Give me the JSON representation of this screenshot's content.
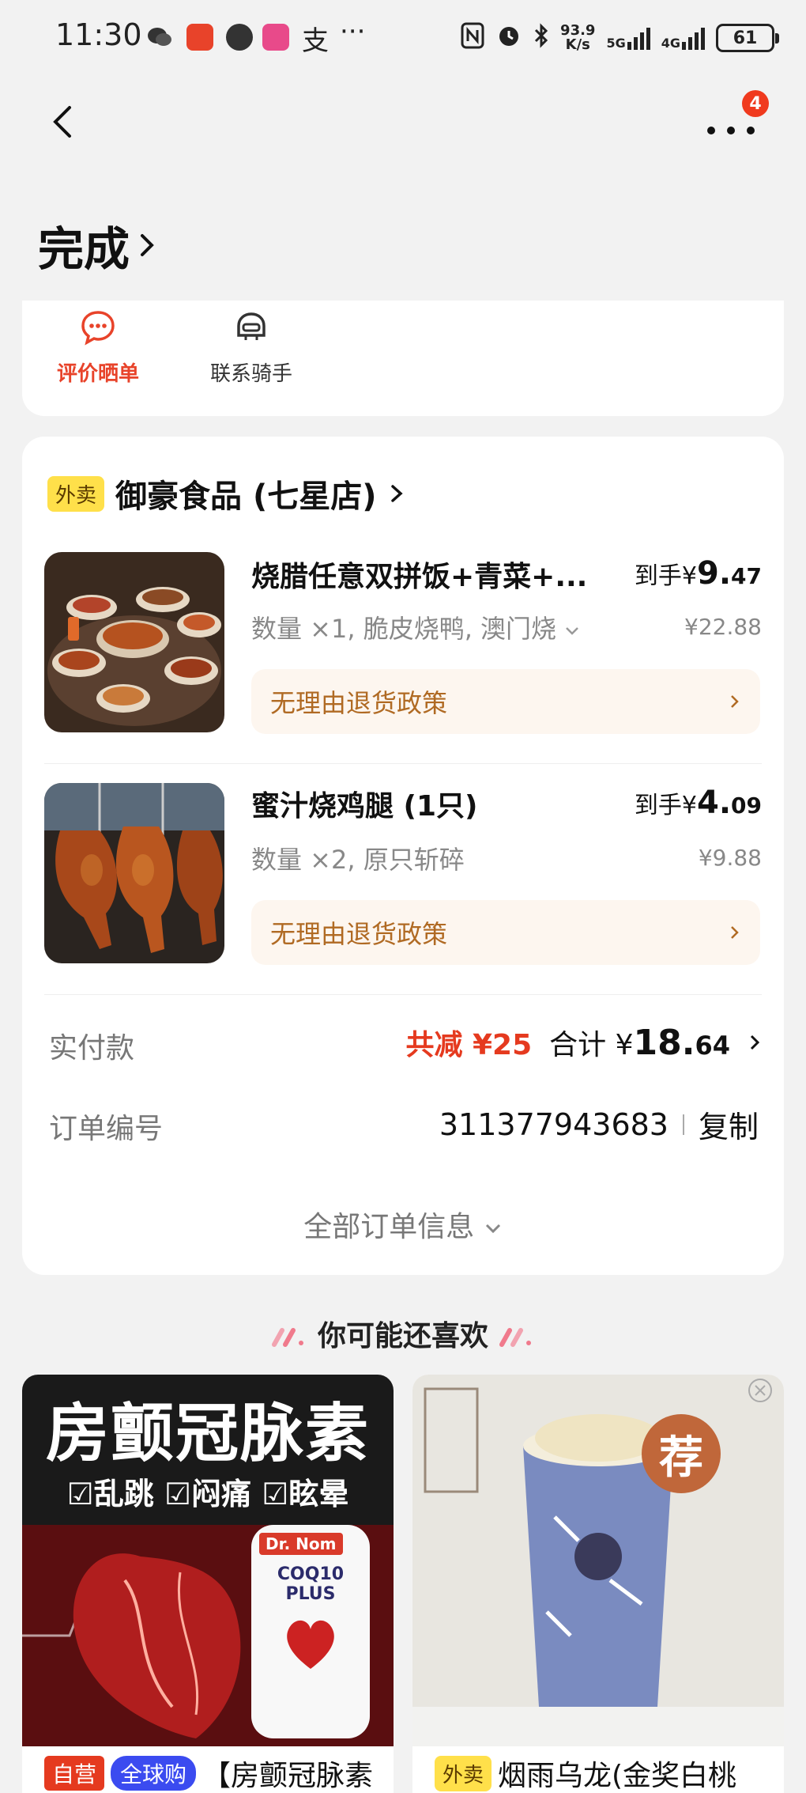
{
  "status_bar": {
    "time": "11:30",
    "net_speed_value": "93.9",
    "net_speed_unit": "K/s",
    "net_5g": "5G",
    "net_4g": "4G",
    "battery": "61",
    "pay_glyph": "支",
    "more_glyph": "···"
  },
  "nav": {
    "badge_count": "4"
  },
  "order_status": {
    "title": "完成"
  },
  "actions": [
    {
      "label": "评价晒单",
      "icon": "chat-bubble-icon",
      "color": "#e8432a"
    },
    {
      "label": "联系骑手",
      "icon": "rider-helmet-icon",
      "color": "#333333"
    }
  ],
  "shop": {
    "tag": "外卖",
    "name": "御豪食品 (七星店)"
  },
  "items": [
    {
      "name": "烧腊任意双拼饭+青菜+...",
      "spec": "数量 ×1, 脆皮烧鸭, 澳门烧",
      "hand_prefix": "到手¥",
      "hand_int": "9.",
      "hand_dec": "47",
      "orig_price": "¥22.88",
      "policy": "无理由退货政策"
    },
    {
      "name": "蜜汁烧鸡腿 (1只)",
      "spec": "数量 ×2, 原只斩碎",
      "hand_prefix": "到手¥",
      "hand_int": "4.",
      "hand_dec": "09",
      "orig_price": "¥9.88",
      "policy": "无理由退货政策"
    }
  ],
  "payment": {
    "label": "实付款",
    "saving": "共减 ¥25",
    "total_prefix": "合计 ¥",
    "total_int": "18.",
    "total_dec": "64"
  },
  "order_no": {
    "label": "订单编号",
    "value": "311377943683",
    "copy_label": "复制"
  },
  "all_info_label": "全部订单信息",
  "recommend": {
    "title": "你可能还喜欢",
    "cards": [
      {
        "poster_title": "房颤冠脉素",
        "poster_checks": "☑乱跳 ☑闷痛 ☑眩晕",
        "bottle_brand": "Dr. Nom",
        "bottle_name": "COQ10 PLUS",
        "tag1": "自营",
        "tag2": "全球购",
        "name": "【房颤冠脉素"
      },
      {
        "badge": "荐",
        "tag1": "外卖",
        "name": "烟雨乌龙(金奖白桃"
      }
    ]
  }
}
